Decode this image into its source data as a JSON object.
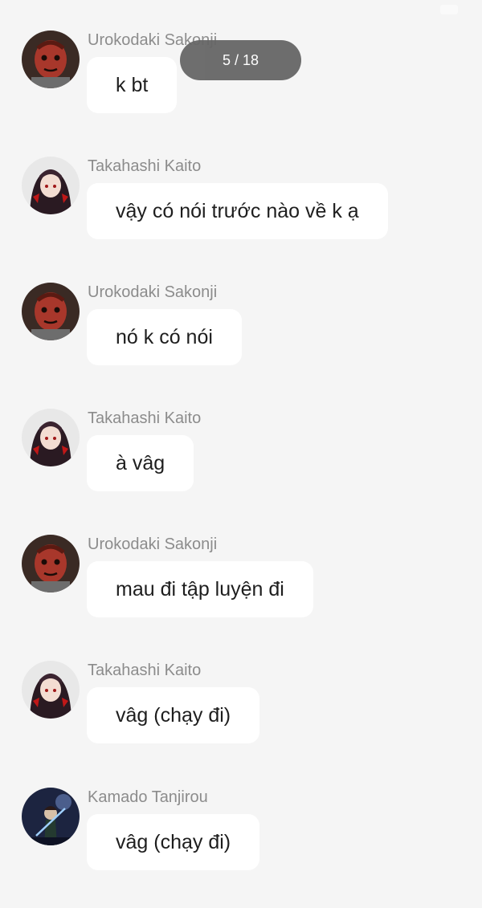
{
  "status_bar": {
    "time_text": ""
  },
  "viewer": {
    "page_counter": "5 / 18"
  },
  "messages": [
    {
      "sender": "Urokodaki Sakonji",
      "text": "k bt",
      "avatar": "oni-mask-avatar"
    },
    {
      "sender": "Takahashi Kaito",
      "text": "vậy có nói trước nào về k ạ",
      "avatar": "anime-girl-avatar"
    },
    {
      "sender": "Urokodaki Sakonji",
      "text": "nó k có nói",
      "avatar": "oni-mask-avatar"
    },
    {
      "sender": "Takahashi Kaito",
      "text": "à vâg",
      "avatar": "anime-girl-avatar"
    },
    {
      "sender": "Urokodaki Sakonji",
      "text": "mau đi tập luyện đi",
      "avatar": "oni-mask-avatar"
    },
    {
      "sender": "Takahashi Kaito",
      "text": "vâg (chạy đi)",
      "avatar": "anime-girl-avatar"
    },
    {
      "sender": "Kamado Tanjirou",
      "text": "vâg (chạy đi)",
      "avatar": "swordsman-avatar"
    }
  ],
  "colors": {
    "background": "#f5f5f5",
    "bubble": "#ffffff",
    "sender_name": "#8c8c8c",
    "message_text": "#1e1e1e",
    "page_counter_bg": "#666666"
  }
}
